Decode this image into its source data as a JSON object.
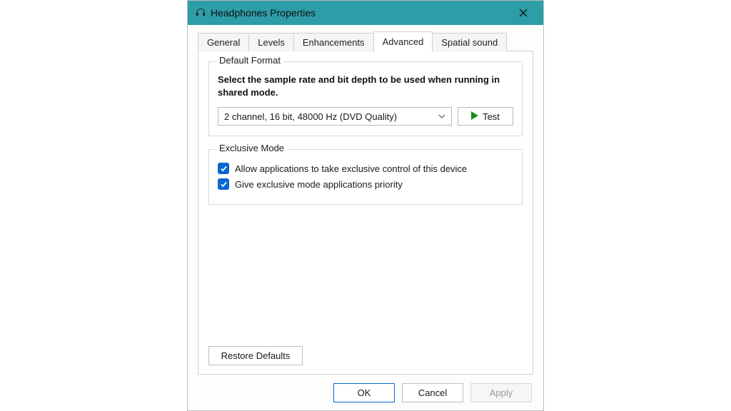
{
  "window": {
    "title": "Headphones Properties"
  },
  "tabs": {
    "general": "General",
    "levels": "Levels",
    "enhancements": "Enhancements",
    "advanced": "Advanced",
    "spatial": "Spatial sound",
    "active": "advanced"
  },
  "default_format": {
    "legend": "Default Format",
    "description": "Select the sample rate and bit depth to be used when running in shared mode.",
    "selected": "2 channel, 16 bit, 48000 Hz (DVD Quality)",
    "test_label": "Test"
  },
  "exclusive_mode": {
    "legend": "Exclusive Mode",
    "allow_label": "Allow applications to take exclusive control of this device",
    "allow_checked": true,
    "priority_label": "Give exclusive mode applications priority",
    "priority_checked": true
  },
  "restore_label": "Restore Defaults",
  "footer": {
    "ok": "OK",
    "cancel": "Cancel",
    "apply": "Apply"
  }
}
